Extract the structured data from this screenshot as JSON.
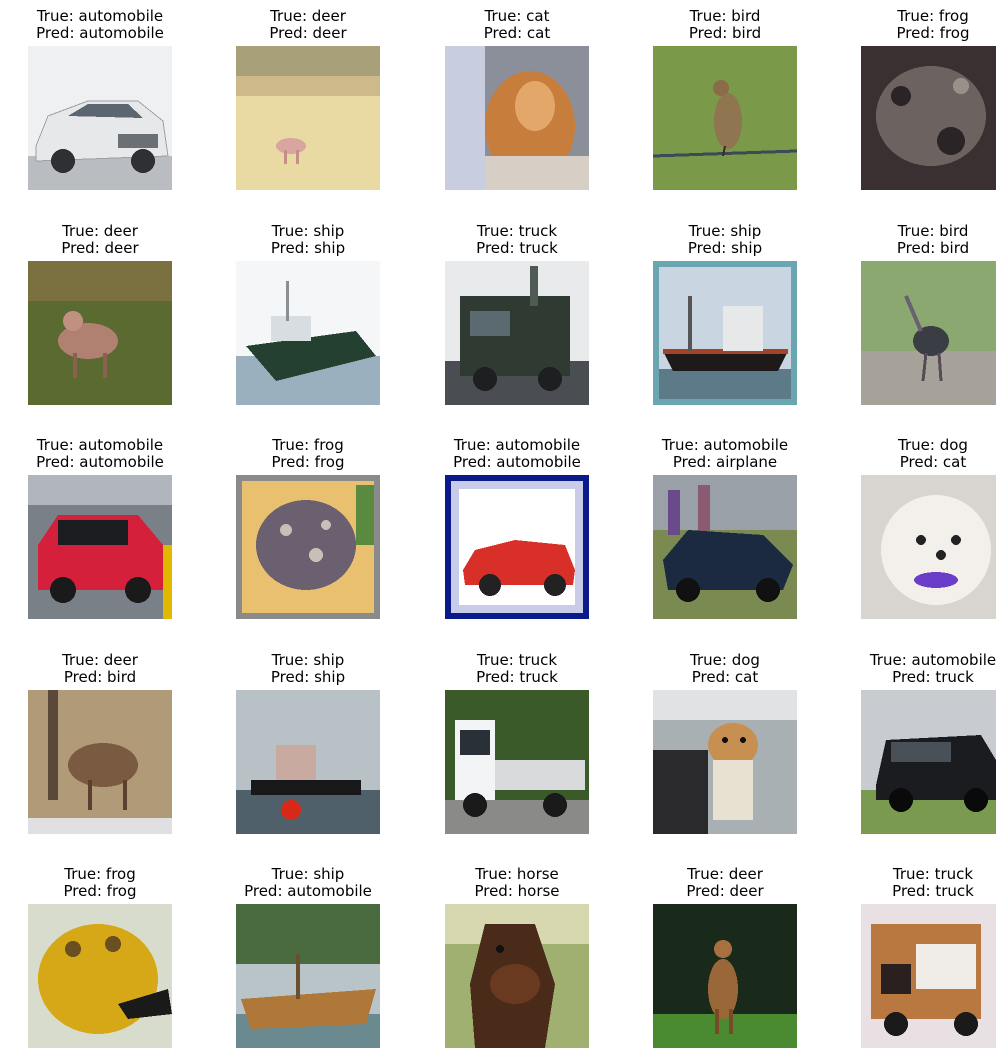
{
  "items": [
    {
      "true_label": "True: automobile",
      "pred_label": "Pred: automobile",
      "scene": "white-car"
    },
    {
      "true_label": "True: deer",
      "pred_label": "Pred: deer",
      "scene": "deer-field"
    },
    {
      "true_label": "True: cat",
      "pred_label": "Pred: cat",
      "scene": "cat-orange"
    },
    {
      "true_label": "True: bird",
      "pred_label": "Pred: bird",
      "scene": "bird-wire"
    },
    {
      "true_label": "True: frog",
      "pred_label": "Pred: frog",
      "scene": "frog-dark"
    },
    {
      "true_label": "True: deer",
      "pred_label": "Pred: deer",
      "scene": "deer-grass"
    },
    {
      "true_label": "True: ship",
      "pred_label": "Pred: ship",
      "scene": "ship-boat"
    },
    {
      "true_label": "True: truck",
      "pred_label": "Pred: truck",
      "scene": "truck-green"
    },
    {
      "true_label": "True: ship",
      "pred_label": "Pred: ship",
      "scene": "ship-cargo"
    },
    {
      "true_label": "True: bird",
      "pred_label": "Pred: bird",
      "scene": "bird-ostrich"
    },
    {
      "true_label": "True: automobile",
      "pred_label": "Pred: automobile",
      "scene": "car-red-smart"
    },
    {
      "true_label": "True: frog",
      "pred_label": "Pred: frog",
      "scene": "frog-pattern"
    },
    {
      "true_label": "True: automobile",
      "pred_label": "Pred: automobile",
      "scene": "car-red-framed"
    },
    {
      "true_label": "True: automobile",
      "pred_label": "Pred: airplane",
      "scene": "car-blue-crowd"
    },
    {
      "true_label": "True: dog",
      "pred_label": "Pred: cat",
      "scene": "dog-white"
    },
    {
      "true_label": "True: deer",
      "pred_label": "Pred: bird",
      "scene": "deer-brown"
    },
    {
      "true_label": "True: ship",
      "pred_label": "Pred: ship",
      "scene": "ship-red-buoy"
    },
    {
      "true_label": "True: truck",
      "pred_label": "Pred: truck",
      "scene": "truck-white"
    },
    {
      "true_label": "True: dog",
      "pred_label": "Pred: cat",
      "scene": "dog-tan"
    },
    {
      "true_label": "True: automobile",
      "pred_label": "Pred: truck",
      "scene": "car-dark-suv"
    },
    {
      "true_label": "True: frog",
      "pred_label": "Pred: frog",
      "scene": "frog-yellow"
    },
    {
      "true_label": "True: ship",
      "pred_label": "Pred: automobile",
      "scene": "ship-wood"
    },
    {
      "true_label": "True: horse",
      "pred_label": "Pred: horse",
      "scene": "horse-brown"
    },
    {
      "true_label": "True: deer",
      "pred_label": "Pred: deer",
      "scene": "deer-forest"
    },
    {
      "true_label": "True: truck",
      "pred_label": "Pred: truck",
      "scene": "truck-orange"
    }
  ]
}
